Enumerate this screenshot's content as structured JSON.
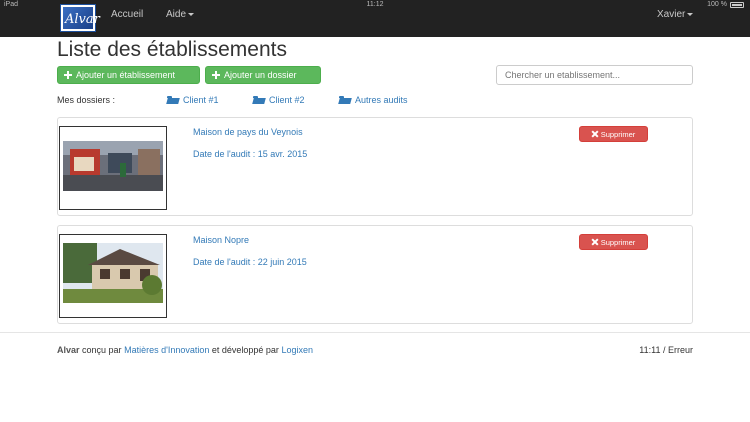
{
  "statusbar": {
    "carrier": "iPad",
    "time": "11:12",
    "battery": "100 %"
  },
  "navbar": {
    "logo_text": "Alvar",
    "home_label": "Accueil",
    "help_label": "Aide",
    "user_label": "Xavier"
  },
  "page": {
    "title": "Liste des établissements"
  },
  "toolbar": {
    "add_establishment_label": "Ajouter un établissement",
    "add_folder_label": "Ajouter un dossier",
    "search_placeholder": "Chercher un etablissement...",
    "search_value": ""
  },
  "folders": {
    "label": "Mes dossiers :",
    "items": [
      {
        "label": "Client #1"
      },
      {
        "label": "Client #2"
      },
      {
        "label": "Autres audits"
      }
    ]
  },
  "establishments": [
    {
      "name": "Maison de pays du Veynois",
      "date": "Date de l'audit : 15 avr. 2015",
      "delete_label": "Supprimer"
    },
    {
      "name": "Maison Nopre",
      "date": "Date de l'audit : 22 juin 2015",
      "delete_label": "Supprimer"
    }
  ],
  "footer": {
    "brand": "Alvar",
    "text1": "conçu par",
    "link1": "Matières d'Innovation",
    "text2": "et développé par",
    "link2": "Logixen",
    "status": "11:11 / Erreur"
  },
  "icons": {
    "add": "plus-icon",
    "folder": "folder-open-icon",
    "delete": "remove-icon"
  }
}
